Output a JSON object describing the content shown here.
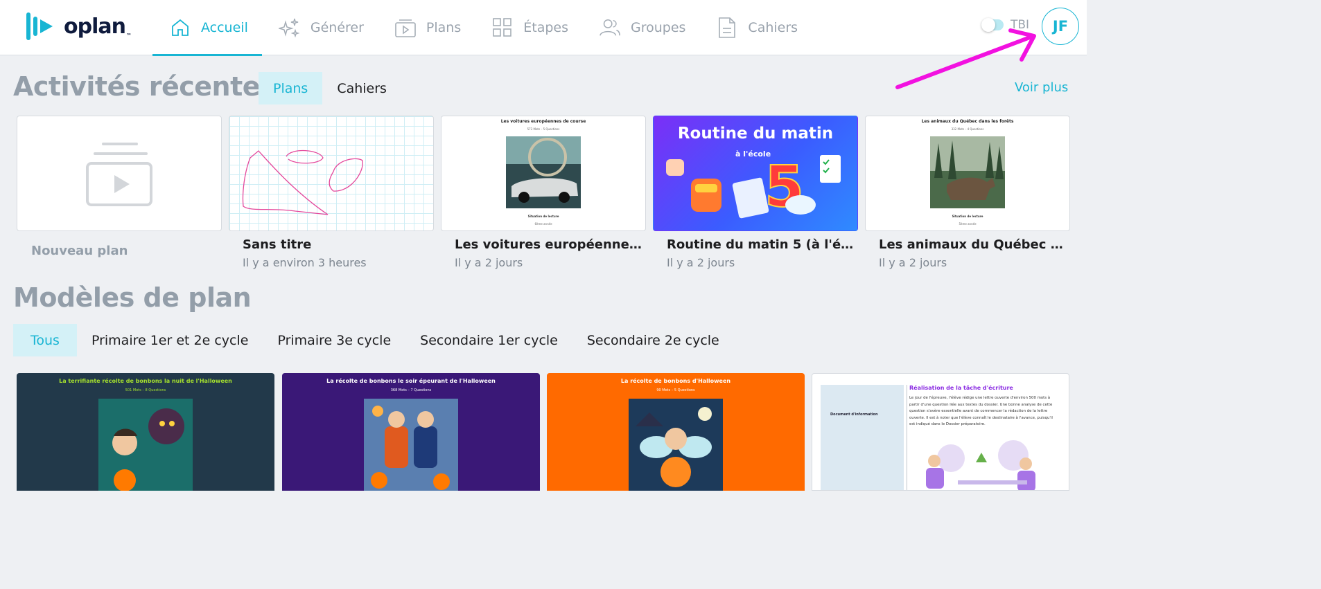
{
  "app": {
    "logo_text": "oplan",
    "logo_tm": "™",
    "brand_color": "#18b5d3"
  },
  "nav": {
    "items": [
      {
        "label": "Accueil",
        "icon": "home-icon",
        "active": true
      },
      {
        "label": "Générer",
        "icon": "sparkles-icon"
      },
      {
        "label": "Plans",
        "icon": "play-board-icon"
      },
      {
        "label": "Étapes",
        "icon": "grid-icon"
      },
      {
        "label": "Groupes",
        "icon": "users-icon"
      },
      {
        "label": "Cahiers",
        "icon": "document-icon"
      }
    ],
    "tbi_label": "TBI",
    "tbi_enabled": false,
    "avatar_initials": "JF"
  },
  "recent": {
    "title": "Activités récentes",
    "tabs": [
      "Plans",
      "Cahiers"
    ],
    "active_tab": "Plans",
    "more_link": "Voir plus",
    "cards": [
      {
        "title": "Nouveau plan",
        "subtitle": ""
      },
      {
        "title": "Sans titre",
        "subtitle": "Il y a environ 3 heures"
      },
      {
        "title": "Les voitures européennes de course",
        "subtitle": "Il y a 2 jours",
        "thumb": {
          "heading": "Les voitures européennes de course",
          "meta": "573 Mots – 5 Questions",
          "footer": "Situation de lecture",
          "footer2": "6ème année"
        }
      },
      {
        "title": "Routine du matin 5 (à l'école)",
        "subtitle": "Il y a 2 jours",
        "thumb": {
          "heading": "Routine du matin",
          "subheading": "à l'école",
          "number": "5"
        }
      },
      {
        "title": "Les animaux du Québec dans les forêts",
        "subtitle": "Il y a 2 jours",
        "thumb": {
          "heading": "Les animaux du Québec dans les forêts",
          "meta": "332 Mots – 4 Questions",
          "footer": "Situation de lecture",
          "footer2": "5ème année"
        }
      }
    ]
  },
  "templates": {
    "title": "Modèles de plan",
    "filters": [
      "Tous",
      "Primaire 1er et 2e cycle",
      "Primaire 3e cycle",
      "Secondaire 1er cycle",
      "Secondaire 2e cycle"
    ],
    "active_filter": "Tous",
    "cards": [
      {
        "heading": "La terrifiante récolte de bonbons la nuit de l'Halloween",
        "meta": "501 Mots – 8 Questions",
        "bg": "#22394a",
        "fg": "#a6e22e"
      },
      {
        "heading": "La récolte de bonbons le soir épeurant de l'Halloween",
        "meta": "368 Mots – 7 Questions",
        "bg": "#3a1877",
        "fg": "#ffffff"
      },
      {
        "heading": "La récolte de bonbons d'Halloween",
        "meta": "90 Mots – 5 Questions",
        "bg": "#ff6a00",
        "fg": "#ffffff"
      },
      {
        "heading": "Réalisation de la tâche d'écriture",
        "doc_title": "Document d'information",
        "body": "Le jour de l'épreuve, l'élève rédige une lettre ouverte d'environ 500 mots à partir d'une question liée aux textes du dossier. Une bonne analyse de cette question s'avère essentielle avant de commencer la rédaction de la lettre ouverte. Il est à noter que l'élève connaît le destinataire à l'avance, puisqu'il est indiqué dans le Dossier préparatoire.",
        "bg": "#ffffff",
        "fg": "#8a2be2"
      }
    ]
  }
}
